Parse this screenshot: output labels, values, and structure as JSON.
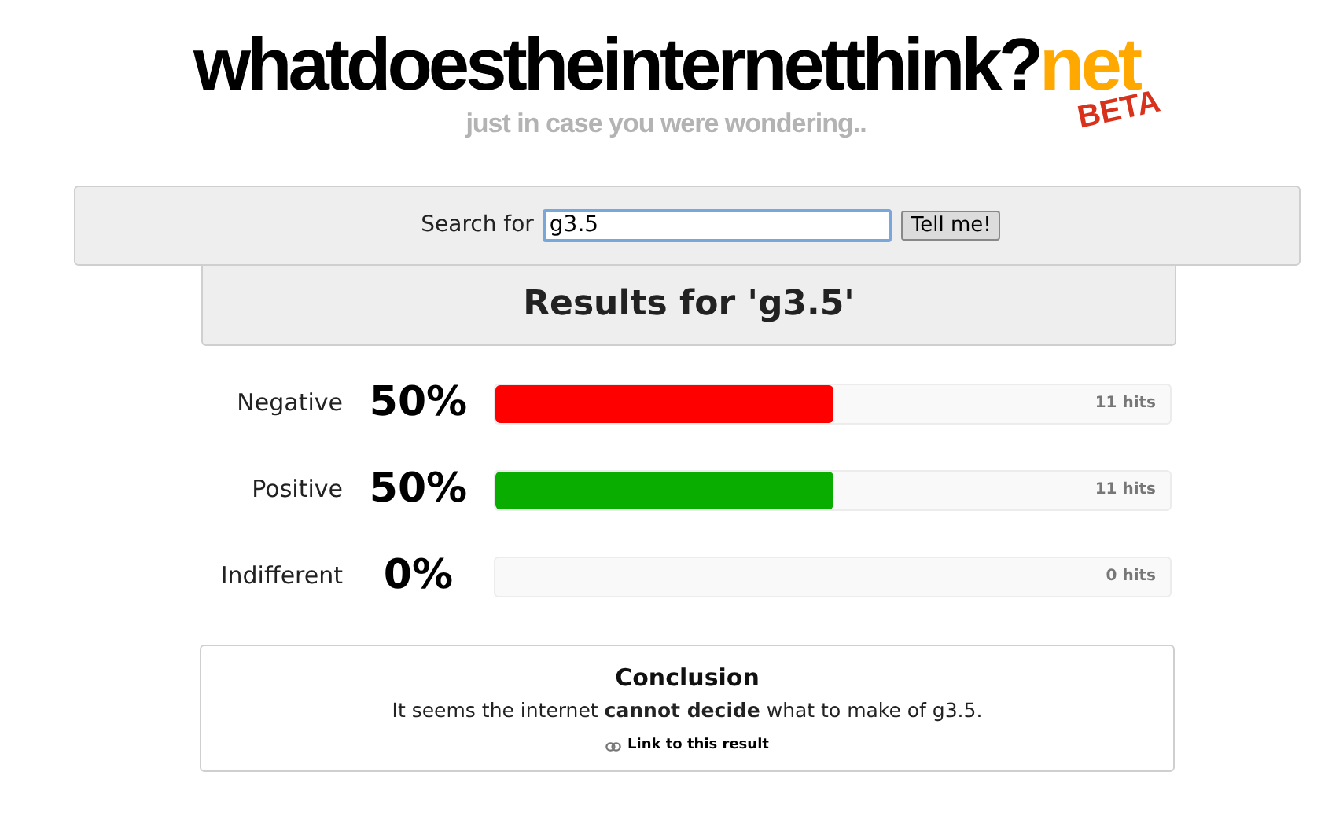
{
  "logo": {
    "main": "whatdoestheinternetthink?",
    "tld": "net",
    "badge": "BETA"
  },
  "tagline": "just in case you were wondering..",
  "search": {
    "label": "Search for",
    "value": "g3.5",
    "button": "Tell me!"
  },
  "results_title": "Results for 'g3.5'",
  "rows": [
    {
      "label": "Negative",
      "percent": "50%",
      "level": 0.5,
      "color": "#ff0000",
      "hits": "11 hits"
    },
    {
      "label": "Positive",
      "percent": "50%",
      "level": 0.5,
      "color": "#08ad00",
      "hits": "11 hits"
    },
    {
      "label": "Indifferent",
      "percent": "0%",
      "hits": "0 hits"
    }
  ],
  "conclusion": {
    "title": "Conclusion",
    "text": "It seems the internet **cannot decide** what to make of g3.5.",
    "link": "Link to this result"
  }
}
